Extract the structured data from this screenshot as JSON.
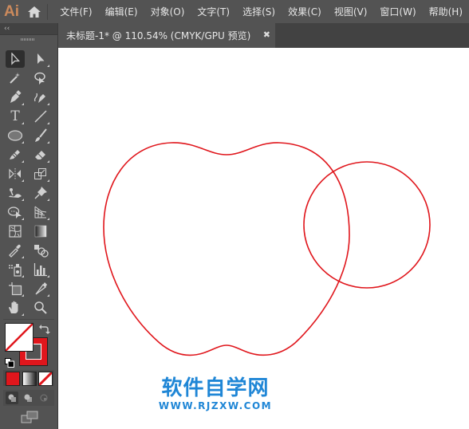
{
  "app": {
    "logo": "Ai",
    "home_icon": "home-icon"
  },
  "menu": {
    "items": [
      {
        "label": "文件(F)"
      },
      {
        "label": "编辑(E)"
      },
      {
        "label": "对象(O)"
      },
      {
        "label": "文字(T)"
      },
      {
        "label": "选择(S)"
      },
      {
        "label": "效果(C)"
      },
      {
        "label": "视图(V)"
      },
      {
        "label": "窗口(W)"
      },
      {
        "label": "帮助(H)"
      }
    ]
  },
  "panel": {
    "collapse_label": "‹‹"
  },
  "document_tab": {
    "title": "未标题-1* @ 110.54% (CMYK/GPU 预览)",
    "close_label": "✖"
  },
  "tools": [
    {
      "name": "selection-tool",
      "active": true
    },
    {
      "name": "direct-selection-tool"
    },
    {
      "name": "magic-wand-tool"
    },
    {
      "name": "lasso-tool"
    },
    {
      "name": "pen-tool"
    },
    {
      "name": "curvature-tool"
    },
    {
      "name": "type-tool",
      "glyph": "T"
    },
    {
      "name": "line-segment-tool"
    },
    {
      "name": "ellipse-tool"
    },
    {
      "name": "paintbrush-tool"
    },
    {
      "name": "shaper-tool"
    },
    {
      "name": "eraser-tool"
    },
    {
      "name": "reflect-tool"
    },
    {
      "name": "scale-tool"
    },
    {
      "name": "puppet-warp-tool"
    },
    {
      "name": "pin-tool"
    },
    {
      "name": "shape-builder-tool"
    },
    {
      "name": "perspective-grid-tool"
    },
    {
      "name": "mesh-tool"
    },
    {
      "name": "gradient-tool"
    },
    {
      "name": "eyedropper-tool"
    },
    {
      "name": "blend-tool"
    },
    {
      "name": "symbol-sprayer-tool"
    },
    {
      "name": "column-graph-tool"
    },
    {
      "name": "artboard-tool"
    },
    {
      "name": "slice-tool"
    },
    {
      "name": "hand-tool"
    },
    {
      "name": "zoom-tool"
    }
  ],
  "colors": {
    "fill": "#ffffff",
    "stroke": "#e0161c",
    "accent_logo": "#cc8a5c",
    "watermark": "#1f86d6"
  },
  "artwork": {
    "shapes": [
      {
        "type": "apple-outline",
        "stroke": "#e0161c"
      },
      {
        "type": "circle",
        "stroke": "#e0161c"
      }
    ]
  },
  "watermark": {
    "title": "软件自学网",
    "url": "WWW.RJZXW.COM"
  }
}
